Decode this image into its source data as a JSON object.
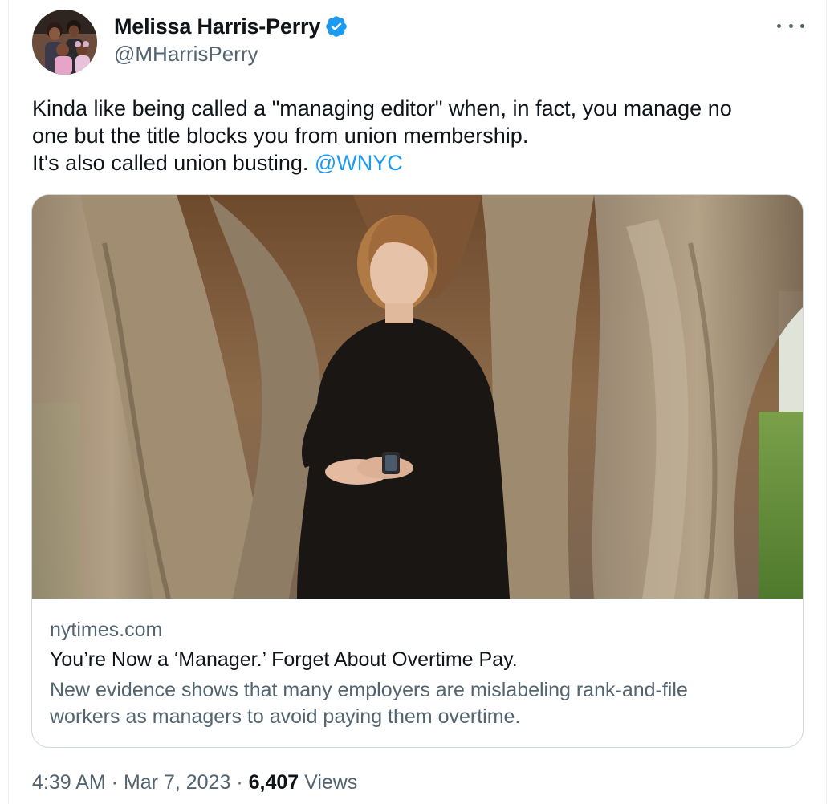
{
  "author": {
    "display_name": "Melissa Harris-Perry",
    "handle": "@MHarrisPerry",
    "verified": true,
    "verified_badge_icon": "verified-badge-icon",
    "verified_color": "#1d9bf0"
  },
  "more_menu_icon": "more-horizontal-icon",
  "tweet": {
    "text_lines": [
      "Kinda like being called a \"managing editor\" when, in fact, you manage no",
      "one but the title blocks you from union membership.",
      "It's also called union busting. "
    ],
    "mention": "@WNYC",
    "mention_color": "#1d9bf0"
  },
  "link_card": {
    "domain": "nytimes.com",
    "title": "You’re Now a ‘Manager.’ Forget About Overtime Pay.",
    "description_lines": [
      "New evidence shows that many employers are mislabeling rank-and-file",
      "workers as managers to avoid paying them overtime."
    ]
  },
  "meta": {
    "time": "4:39 AM",
    "separator": " · ",
    "date": "Mar 7, 2023",
    "views_count": "6,407",
    "views_label": " Views"
  }
}
